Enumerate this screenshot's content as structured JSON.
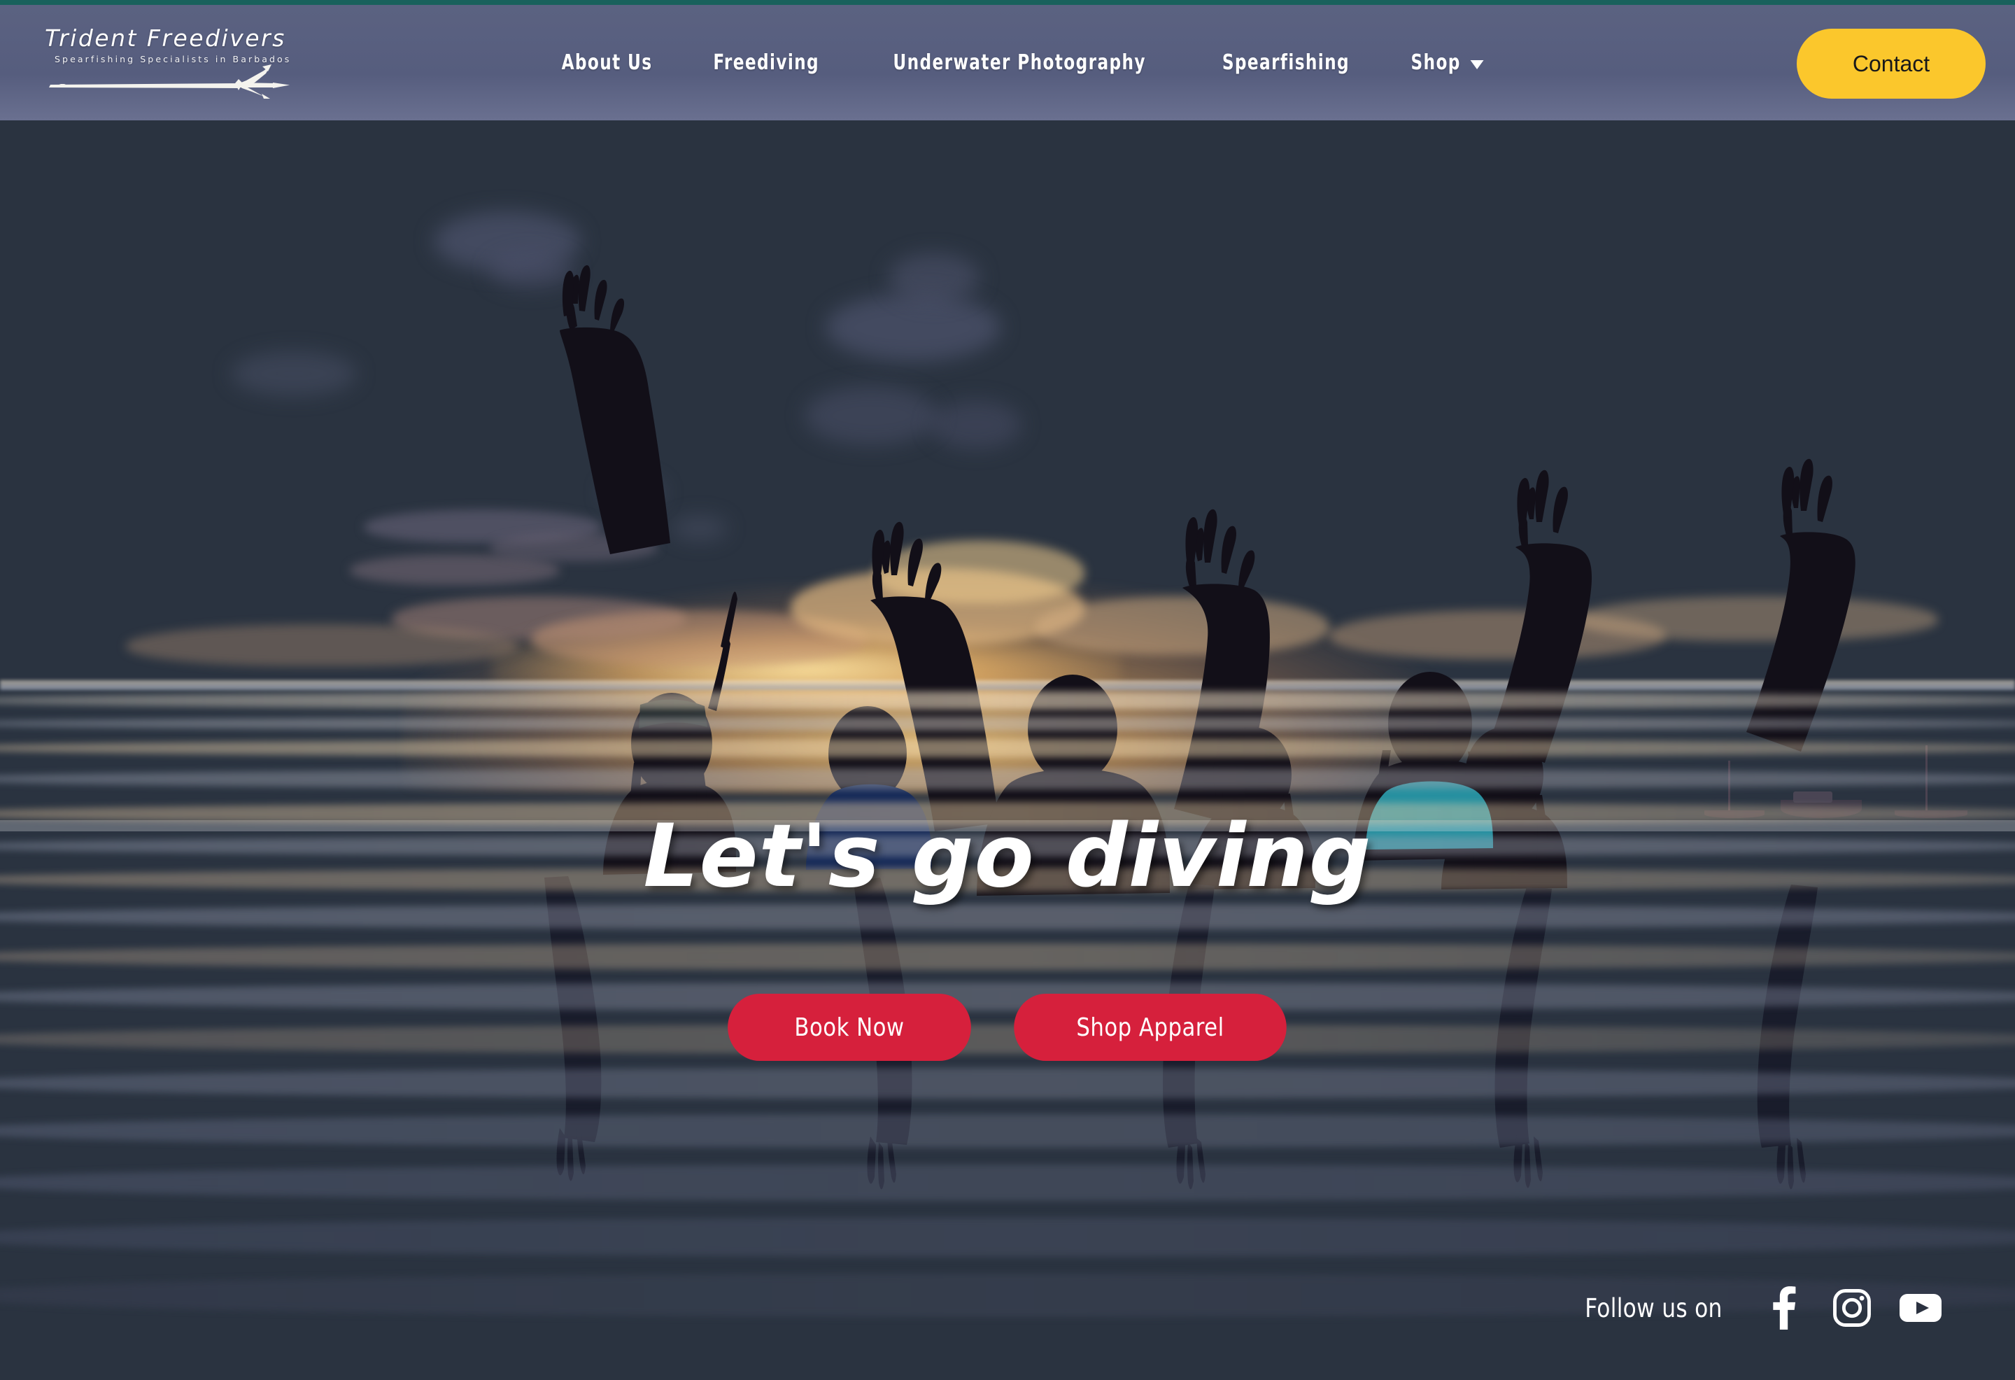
{
  "brand": {
    "name": "Trident Freedivers",
    "tagline": "Spearfishing Specialists in Barbados",
    "logo_icon": "trident-icon",
    "accent_strip_color": "#19615c",
    "header_bg_color": "#565d7e"
  },
  "nav": {
    "items": [
      {
        "label": "About Us",
        "has_dropdown": false
      },
      {
        "label": "Freediving",
        "has_dropdown": false
      },
      {
        "label": "Underwater Photography",
        "has_dropdown": false
      },
      {
        "label": "Spearfishing",
        "has_dropdown": false
      },
      {
        "label": "Shop",
        "has_dropdown": true
      }
    ],
    "contact": {
      "label": "Contact",
      "bg_color": "#fbc72c",
      "text_color": "#18181a"
    }
  },
  "hero": {
    "headline": "Let's go diving",
    "headline_color": "#ffffff",
    "buttons": [
      {
        "label": "Book Now",
        "bg_color": "#d6203c",
        "text_color": "#ffffff"
      },
      {
        "label": "Shop Apparel",
        "bg_color": "#d6203c",
        "text_color": "#ffffff"
      }
    ],
    "background_description": "Group of freedivers in the ocean at sunset with arms raised"
  },
  "footer": {
    "follow_label": "Follow us on",
    "socials": [
      {
        "name": "facebook-icon",
        "label": "Facebook"
      },
      {
        "name": "instagram-icon",
        "label": "Instagram"
      },
      {
        "name": "youtube-icon",
        "label": "YouTube"
      }
    ]
  }
}
